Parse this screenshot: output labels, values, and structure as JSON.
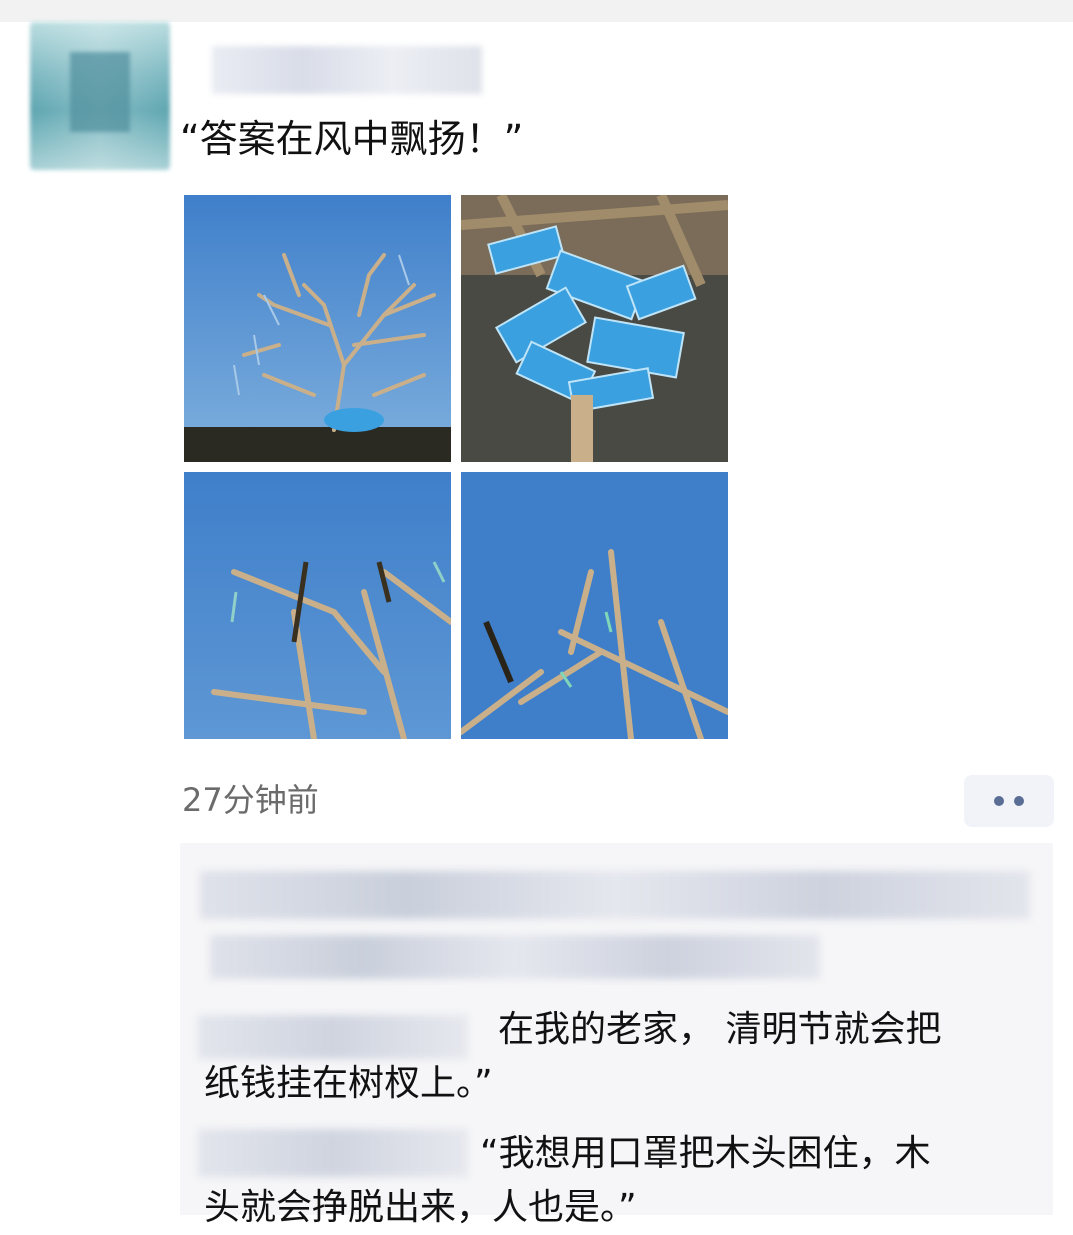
{
  "post": {
    "text": "“答案在风中飘扬！”",
    "timestamp": "27分钟前",
    "photos": [
      {
        "name": "photo-tree-branches-sky"
      },
      {
        "name": "photo-blue-masks-on-wood"
      },
      {
        "name": "photo-branches-closeup-left"
      },
      {
        "name": "photo-branches-closeup-right"
      }
    ]
  },
  "comments": [
    {
      "line1": "在我的老家， 清明节就会把",
      "line2": "纸钱挂在树杈上。”"
    },
    {
      "line1": "“我想用口罩把木头困住，木",
      "line2": "头就会挣脱出来，人也是。”"
    }
  ],
  "colors": {
    "sky": "#4d8bd0",
    "mask_blue": "#3aa0e0",
    "wood": "#c9b08a",
    "link_dots": "#5a6d94",
    "comment_bg": "#f6f6f8"
  }
}
